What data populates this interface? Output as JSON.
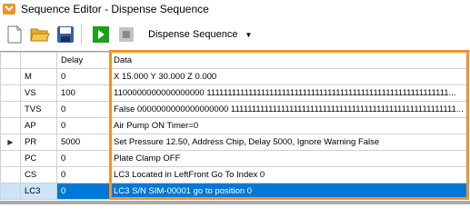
{
  "window": {
    "title": "Sequence Editor - Dispense Sequence"
  },
  "toolbar": {
    "new_icon": "new-document-icon",
    "open_icon": "open-folder-icon",
    "save_icon": "save-disk-icon",
    "run_icon": "play-icon",
    "stop_icon": "stop-icon",
    "sequence_selected": "Dispense Sequence",
    "colors": {
      "run": "#1ea01e",
      "stop": "#a0a0a0",
      "folder": "#e8b02a",
      "save": "#3a5fa8"
    }
  },
  "grid": {
    "headers": {
      "code": "",
      "delay": "Delay",
      "data": "Data"
    },
    "current_row_indicator": "▶",
    "rows": [
      {
        "code": "M",
        "delay": "0",
        "data": "X 15.000 Y 30.000 Z 0.000"
      },
      {
        "code": "VS",
        "delay": "100",
        "data": "1100000000000000000 1111111111111111111111111111111111111111111111111111111111..."
      },
      {
        "code": "TVS",
        "delay": "0",
        "data": "False 0000000000000000000 111111111111111111111111111111111111111111111111111111..."
      },
      {
        "code": "AP",
        "delay": "0",
        "data": "Air Pump ON Timer=0"
      },
      {
        "code": "PR",
        "delay": "5000",
        "data": "Set Pressure 12.50, Address Chip, Delay 5000, Ignore Warning False"
      },
      {
        "code": "PC",
        "delay": "0",
        "data": "Plate Clamp OFF"
      },
      {
        "code": "CS",
        "delay": "0",
        "data": "LC3 Located in LeftFront Go To Index 0"
      },
      {
        "code": "LC3",
        "delay": "0",
        "data": "LC3 S/N SIM-00001 go to position 0"
      }
    ],
    "selected_row": 7,
    "current_row": 4,
    "colors": {
      "selection": "#0078d7",
      "highlight_box": "#f0932b"
    }
  }
}
